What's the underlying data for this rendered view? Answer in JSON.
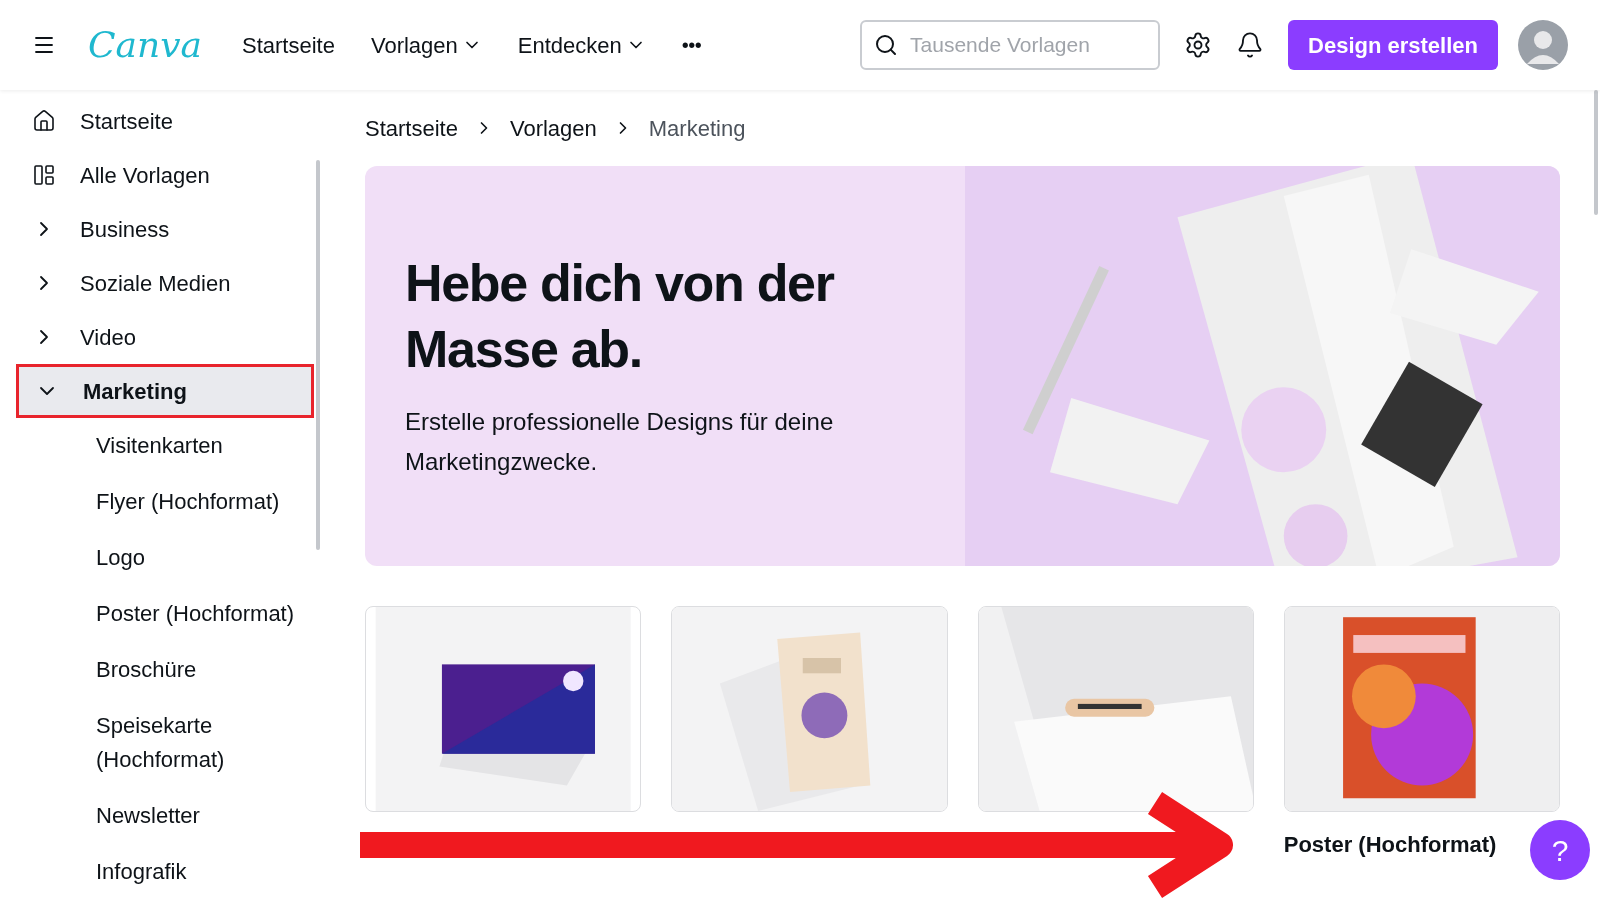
{
  "header": {
    "logo": "Canva",
    "nav": [
      {
        "label": "Startseite",
        "dropdown": false
      },
      {
        "label": "Vorlagen",
        "dropdown": true
      },
      {
        "label": "Entdecken",
        "dropdown": true
      }
    ],
    "more": "•••",
    "search": {
      "placeholder": "Tausende Vorlagen"
    },
    "create_button": "Design erstellen"
  },
  "sidebar": {
    "items": [
      {
        "label": "Startseite",
        "kind": "home",
        "selected": false
      },
      {
        "label": "Alle Vorlagen",
        "kind": "layout",
        "selected": false
      },
      {
        "label": "Business",
        "kind": "category",
        "expanded": false,
        "selected": false
      },
      {
        "label": "Soziale Medien",
        "kind": "category",
        "expanded": false,
        "selected": false
      },
      {
        "label": "Video",
        "kind": "category",
        "expanded": false,
        "selected": false
      },
      {
        "label": "Marketing",
        "kind": "category",
        "expanded": true,
        "selected": true,
        "children": [
          {
            "label": "Visitenkarten"
          },
          {
            "label": "Flyer (Hochformat)"
          },
          {
            "label": "Logo"
          },
          {
            "label": "Poster (Hochformat)"
          },
          {
            "label": "Broschüre"
          },
          {
            "label": "Speisekarte (Hochformat)"
          },
          {
            "label": "Newsletter"
          },
          {
            "label": "Infografik"
          }
        ]
      }
    ]
  },
  "breadcrumb": [
    "Startseite",
    "Vorlagen",
    "Marketing"
  ],
  "banner": {
    "title": "Hebe dich von der Masse ab.",
    "text": "Erstelle professionelle Designs für deine Marketingzwecke."
  },
  "cards": [
    {
      "kind": "picture"
    },
    {
      "kind": "picture"
    },
    {
      "kind": "picture"
    },
    {
      "kind": "picture",
      "caption": "Poster (Hochformat)"
    }
  ],
  "help": "?"
}
